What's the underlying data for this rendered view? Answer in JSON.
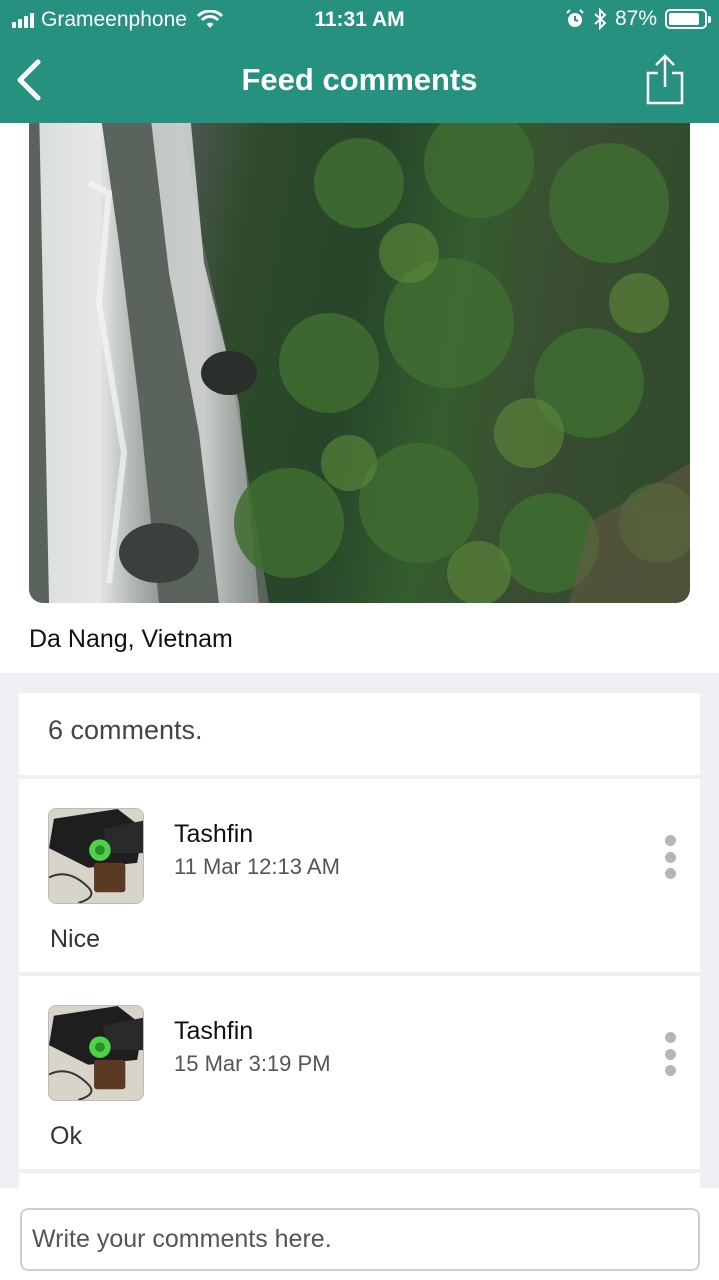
{
  "status_bar": {
    "carrier": "Grameenphone",
    "time": "11:31 AM",
    "battery_percent": "87%",
    "battery_level": 0.87,
    "icons": [
      "signal-icon",
      "wifi-icon",
      "alarm-icon",
      "bluetooth-icon",
      "battery-icon"
    ]
  },
  "nav": {
    "title": "Feed comments",
    "back_icon": "chevron-left-icon",
    "share_icon": "share-icon"
  },
  "post": {
    "image": "waterfall-photo",
    "location": "Da Nang, Vietnam"
  },
  "comments_header": "6 comments.",
  "comments": [
    {
      "name": "Tashfin",
      "time": "11 Mar 12:13 AM",
      "text": "Nice"
    },
    {
      "name": "Tashfin",
      "time": "15 Mar 3:19 PM",
      "text": "Ok"
    }
  ],
  "input": {
    "placeholder": "Write your comments here."
  },
  "colors": {
    "header": "#26917f",
    "background": "#efeff4"
  }
}
